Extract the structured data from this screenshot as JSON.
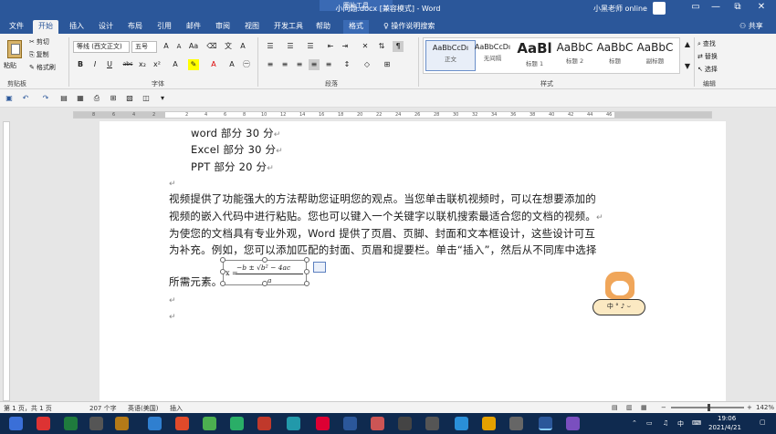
{
  "titlebar": {
    "doc_title": "小问题.docx [兼容模式] - Word",
    "context_tool": "图片工具",
    "user": "小黑老师 online",
    "min": "—",
    "max": "⧉",
    "close": "✕"
  },
  "tabs": [
    "文件",
    "开始",
    "插入",
    "设计",
    "布局",
    "引用",
    "邮件",
    "审阅",
    "视图",
    "开发工具",
    "帮助",
    "格式",
    "操作说明搜索"
  ],
  "share": "共享",
  "clipboard": {
    "paste": "粘贴",
    "cut": "剪切",
    "copy": "复制",
    "format_painter": "格式刷",
    "label": "剪贴板"
  },
  "font": {
    "name": "等线 (西文正文)",
    "size": "五号",
    "label": "字体",
    "buttons": [
      "B",
      "I",
      "U",
      "abc",
      "x₂",
      "x²"
    ]
  },
  "paragraph": {
    "label": "段落"
  },
  "styles": {
    "label": "样式",
    "items": [
      {
        "sample": "AaBbCcDı",
        "name": "正文"
      },
      {
        "sample": "AaBbCcDı",
        "name": "无间隔"
      },
      {
        "sample": "AaBl",
        "name": "标题 1"
      },
      {
        "sample": "AaBbC",
        "name": "标题 2"
      },
      {
        "sample": "AaBbC",
        "name": "标题"
      },
      {
        "sample": "AaBbC",
        "name": "副标题"
      }
    ]
  },
  "editing": {
    "find": "查找",
    "replace": "替换",
    "select": "选择",
    "label": "编辑"
  },
  "ruler_numbers": [
    "8",
    "6",
    "4",
    "2",
    "2",
    "4",
    "6",
    "8",
    "10",
    "12",
    "14",
    "16",
    "18",
    "20",
    "22",
    "24",
    "26",
    "28",
    "30",
    "32",
    "34",
    "36",
    "38",
    "40",
    "42",
    "44",
    "46"
  ],
  "document": {
    "lines": [
      "word 部分 30 分",
      "Excel 部分 30 分",
      "PPT 部分 20 分",
      "视频提供了功能强大的方法帮助您证明您的观点。当您单击联机视频时，可以在想要添加的",
      "视频的嵌入代码中进行粘贴。您也可以键入一个关键字以联机搜索最适合您的文档的视频。",
      "为使您的文档具有专业外观，Word 提供了页眉、页脚、封面和文本框设计，这些设计可互",
      "为补充。例如，您可以添加匹配的封面、页眉和提要栏。单击“插入”，然后从不同库中选择",
      "所需元素。"
    ],
    "paragraph_mark": "↵",
    "equation": {
      "lhs": "x =",
      "numerator": "−b ± √b² − 4ac",
      "denominator": "a"
    },
    "sticker_text": "中 ° ♪ ⌣"
  },
  "status": {
    "page": "第 1 页，共 1 页",
    "words": "207 个字",
    "lang": "英语(美国)",
    "mode": "插入",
    "zoom": "142%"
  },
  "taskbar": {
    "time": "19:06",
    "date": "2021/4/21",
    "ime": "中"
  }
}
